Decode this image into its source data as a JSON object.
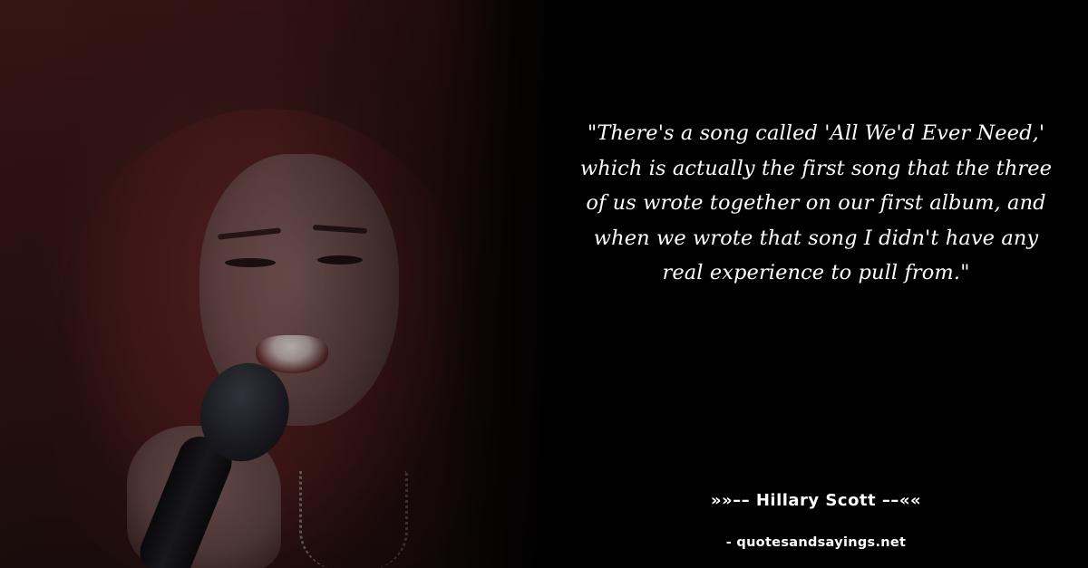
{
  "quote": {
    "text": "\"There's a song called 'All We'd Ever Need,' which is actually the first song that the three of us wrote together on our first album, and when we wrote that song I didn't have any real experience to pull from.\""
  },
  "author": {
    "line": "»»–– Hillary Scott ––««"
  },
  "source": {
    "label": "- quotesandsayings.net"
  },
  "photo": {
    "subject_icon": "singer-with-microphone-photo"
  }
}
